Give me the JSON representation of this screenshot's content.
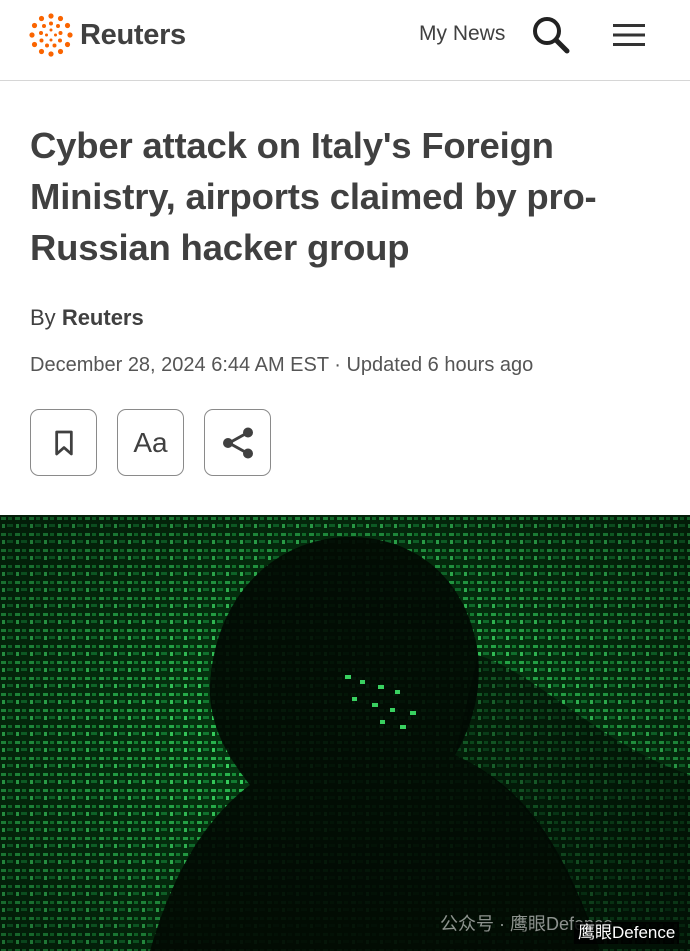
{
  "header": {
    "logo_text": "Reuters",
    "my_news_label": "My News",
    "search_icon": "search-icon",
    "menu_icon": "hamburger-menu-icon",
    "brand_color": "#fa6400"
  },
  "article": {
    "headline": "Cyber attack on Italy's Foreign Ministry, airports claimed by pro-Russian hacker group",
    "by_label": "By",
    "author": "Reuters",
    "dateline": "December 28, 2024 6:44 AM EST · Updated 6 hours ago"
  },
  "actions": {
    "bookmark_icon": "bookmark-icon",
    "text_size_label": "Aa",
    "share_icon": "share-icon"
  },
  "image": {
    "description_icon": "hacker-silhouette-image"
  },
  "watermark": {
    "primary": "公众号 · 鹰眼Defence",
    "secondary": "鹰眼Defence"
  }
}
